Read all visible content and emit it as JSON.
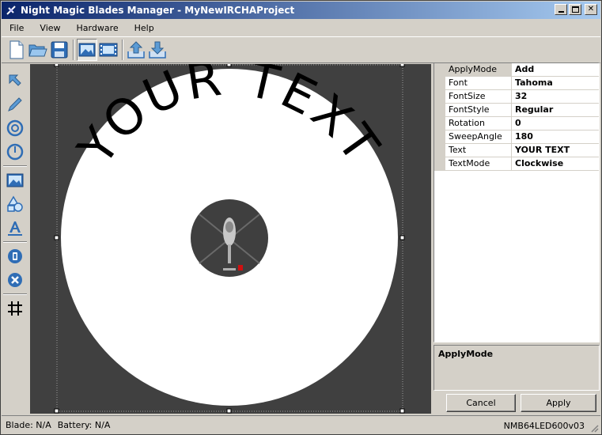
{
  "window": {
    "title": "Night Magic Blades Manager - MyNewIRCHAProject",
    "minimize_icon": "minimize-icon",
    "maximize_icon": "maximize-icon",
    "close_icon": "close-icon"
  },
  "menu": {
    "items": [
      "File",
      "View",
      "Hardware",
      "Help"
    ]
  },
  "toolbar": {
    "icons": [
      "new-file-icon",
      "open-folder-icon",
      "save-icon",
      "image-view-icon",
      "filmstrip-icon",
      "upload-icon",
      "download-icon"
    ]
  },
  "tools": {
    "icons": [
      "select-arrow-icon",
      "pencil-icon",
      "circle-target-icon",
      "dial-icon",
      "image-icon",
      "shapes-icon",
      "text-tool-icon",
      "info-icon",
      "delete-icon",
      "grid-icon"
    ]
  },
  "canvas": {
    "background": "#404040",
    "disc_color": "#ffffff",
    "text": "YOUR TEXT",
    "text_color": "#000000"
  },
  "properties": {
    "rows": [
      {
        "name": "ApplyMode",
        "value": "Add"
      },
      {
        "name": "Font",
        "value": "Tahoma"
      },
      {
        "name": "FontSize",
        "value": "32"
      },
      {
        "name": "FontStyle",
        "value": "Regular"
      },
      {
        "name": "Rotation",
        "value": "0"
      },
      {
        "name": "SweepAngle",
        "value": "180"
      },
      {
        "name": "Text",
        "value": "YOUR TEXT"
      },
      {
        "name": "TextMode",
        "value": "Clockwise"
      }
    ],
    "description_title": "ApplyMode"
  },
  "buttons": {
    "cancel": "Cancel",
    "apply": "Apply"
  },
  "status": {
    "blade": "Blade: N/A",
    "battery": "Battery: N/A",
    "device": "NMB64LED600v03"
  }
}
